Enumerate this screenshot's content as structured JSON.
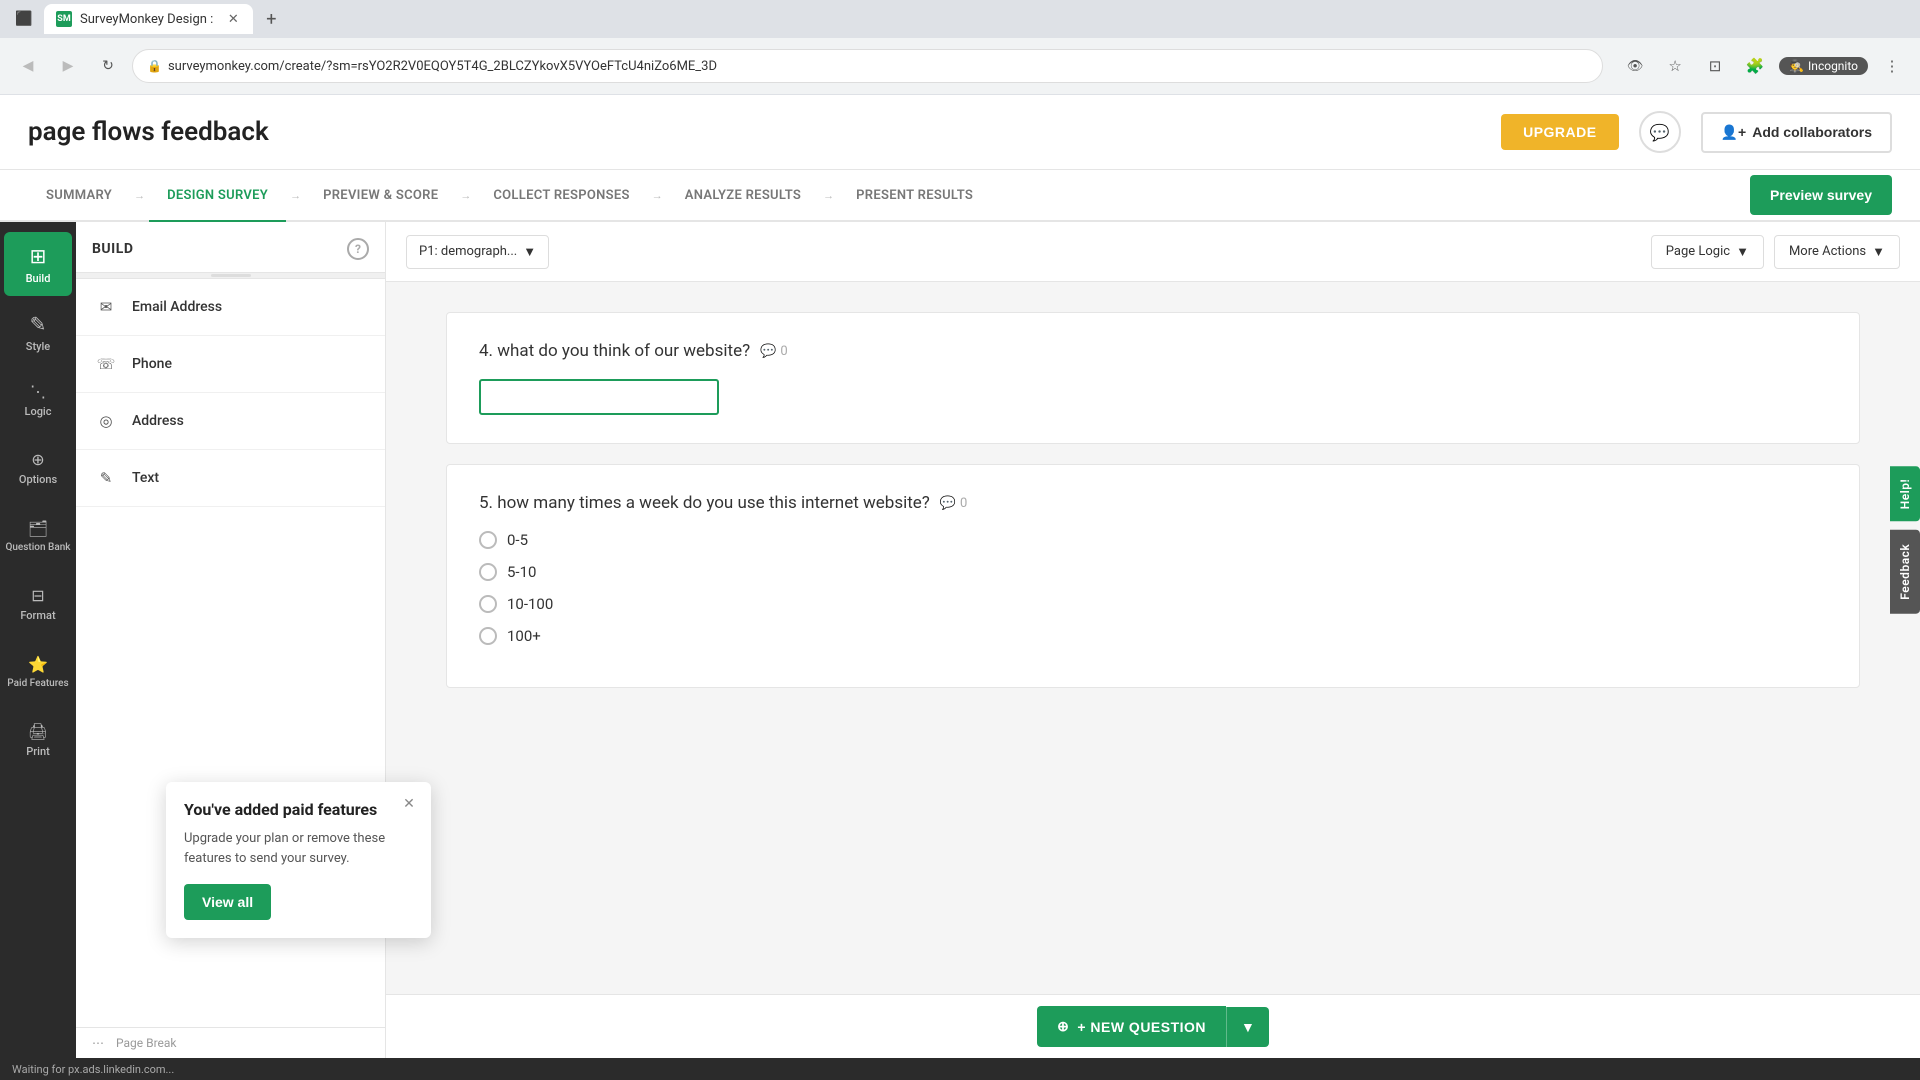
{
  "browser": {
    "tab_title": "SurveyMonkey Design :",
    "tab_favicon": "SM",
    "url": "surveymonkey.com/create/?sm=rsYO2R2V0EQOY5T4G_2BLCZYkovX5VYOeFTcU4niZo6ME_3D",
    "new_tab_icon": "+",
    "nav": {
      "back": "◀",
      "forward": "▶",
      "refresh": "↻",
      "incognito": "Incognito"
    }
  },
  "app": {
    "title": "page flows feedback",
    "upgrade_btn": "UPGRADE",
    "add_collab_btn": "Add collaborators"
  },
  "nav_tabs": [
    {
      "label": "SUMMARY",
      "active": false
    },
    {
      "label": "DESIGN SURVEY",
      "active": true
    },
    {
      "label": "PREVIEW & SCORE",
      "active": false
    },
    {
      "label": "COLLECT RESPONSES",
      "active": false
    },
    {
      "label": "ANALYZE RESULTS",
      "active": false
    },
    {
      "label": "PRESENT RESULTS",
      "active": false
    }
  ],
  "preview_btn": "Preview survey",
  "sidebar": {
    "items": [
      {
        "label": "Build",
        "icon": "⊞",
        "active": true
      },
      {
        "label": "Style",
        "icon": "✎",
        "active": false
      },
      {
        "label": "Logic",
        "icon": "⋱",
        "active": false
      },
      {
        "label": "Options",
        "icon": "⊕",
        "active": false
      },
      {
        "label": "Question Bank",
        "icon": "🗃",
        "active": false
      },
      {
        "label": "Format",
        "icon": "⊟",
        "active": false
      },
      {
        "label": "Paid Features",
        "icon": "★",
        "active": false
      },
      {
        "label": "Print",
        "icon": "🖨",
        "active": false
      }
    ]
  },
  "build_panel": {
    "title": "BUILD",
    "help_icon": "?",
    "items": [
      {
        "icon": "✉",
        "label": "Email Address"
      },
      {
        "icon": "☏",
        "label": "Phone"
      },
      {
        "icon": "◎",
        "label": "Address"
      },
      {
        "icon": "✎",
        "label": "Text"
      }
    ]
  },
  "paid_popup": {
    "title": "You've added paid features",
    "text": "Upgrade your plan or remove these features to send your survey.",
    "view_all_btn": "View all",
    "close_icon": "✕"
  },
  "toolbar": {
    "page_dropdown": "P1: demograph...",
    "page_logic_btn": "Page Logic",
    "more_actions_btn": "More Actions"
  },
  "questions": [
    {
      "number": "4.",
      "text": "what do you think of our website?",
      "comments": "0",
      "type": "text_input"
    },
    {
      "number": "5.",
      "text": "how many times a week do you use this internet website?",
      "comments": "0",
      "type": "radio",
      "options": [
        "0-5",
        "5-10",
        "10-100",
        "100+"
      ]
    }
  ],
  "new_question_btn": "+ NEW QUESTION",
  "feedback_tab": "Feedback",
  "help_tab": "Help!",
  "status_bar": "Waiting for px.ads.linkedin.com..."
}
